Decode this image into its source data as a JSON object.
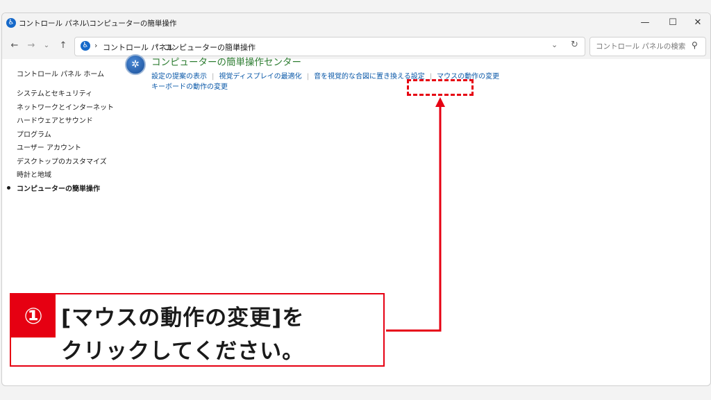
{
  "window": {
    "title": "コントロール パネル\\コンピューターの簡単操作",
    "controls": {
      "minimize": "—",
      "maximize": "☐",
      "close": "✕"
    }
  },
  "nav": {
    "back": "←",
    "forward": "→",
    "recent": "⌄",
    "up": "↑",
    "breadcrumbs": [
      "コントロール パネル",
      "コンピューターの簡単操作"
    ],
    "separator": "›",
    "dropdown": "⌄",
    "refresh": "↻",
    "search_placeholder": "コントロール パネルの検索"
  },
  "sidebar": {
    "home": "コントロール パネル ホーム",
    "items": [
      {
        "label": "システムとセキュリティ",
        "active": false
      },
      {
        "label": "ネットワークとインターネット",
        "active": false
      },
      {
        "label": "ハードウェアとサウンド",
        "active": false
      },
      {
        "label": "プログラム",
        "active": false
      },
      {
        "label": "ユーザー アカウント",
        "active": false
      },
      {
        "label": "デスクトップのカスタマイズ",
        "active": false
      },
      {
        "label": "時計と地域",
        "active": false
      },
      {
        "label": "コンピューターの簡単操作",
        "active": true
      }
    ]
  },
  "main": {
    "title": "コンピューターの簡単操作センター",
    "links": [
      "設定の提案の表示",
      "視覚ディスプレイの最適化",
      "音を視覚的な合図に置き換える設定",
      "マウスの動作の変更"
    ],
    "link_row2": "キーボードの動作の変更"
  },
  "annotation": {
    "badge": "①",
    "line1": "[マウスの動作の変更]を",
    "line2": "クリックしてください。",
    "accent_color": "#e60012"
  }
}
